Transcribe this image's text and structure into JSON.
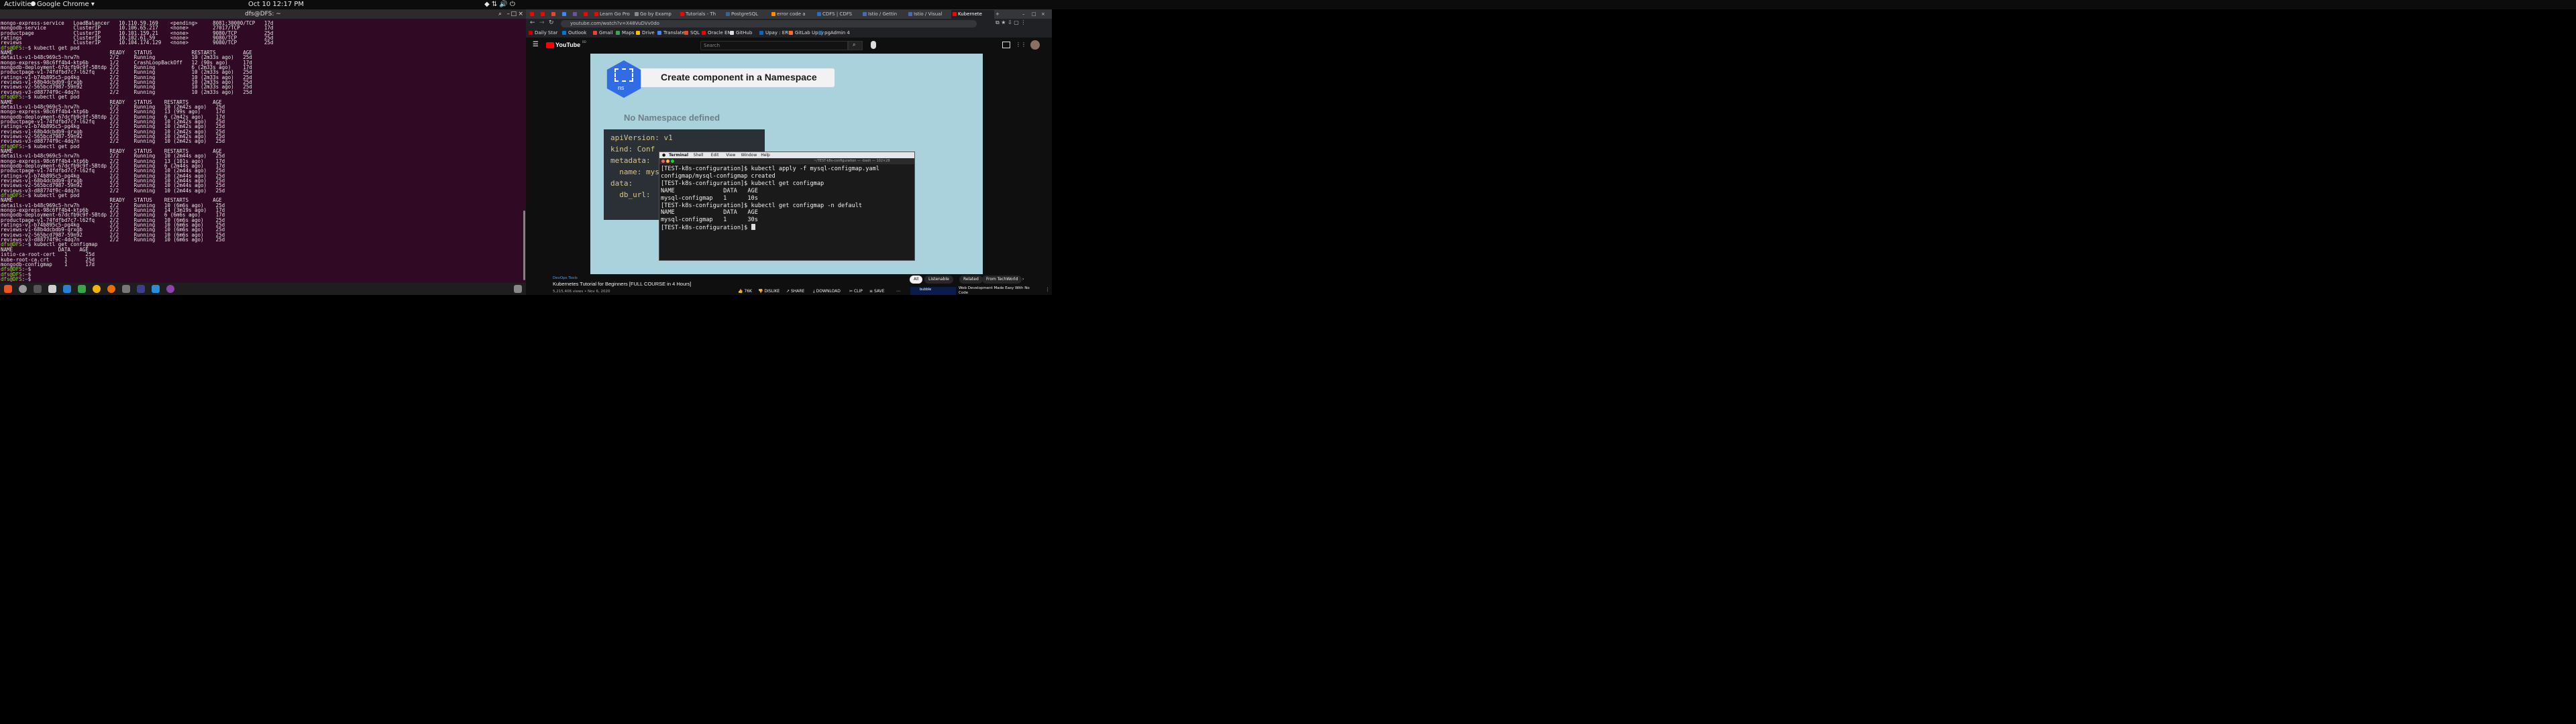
{
  "topbar": {
    "activities": "Activities",
    "app": "Google Chrome",
    "clock": "Oct 10  12:17 PM"
  },
  "terminal": {
    "title": "dfs@DFS: ~",
    "lines": [
      "mongo-express-service   LoadBalancer   10.110.59.169    <pending>     8081:30000/TCP   17d",
      "mongodb-service         ClusterIP      10.106.65.217    <none>        27017/TCP        17d",
      "productpage             ClusterIP      10.101.159.21    <none>        9080/TCP         25d",
      "ratings                 ClusterIP      10.102.61.59     <none>        9080/TCP         25d",
      "reviews                 ClusterIP      10.104.174.129   <none>        9080/TCP         25d",
      "$dfs@DFS:~$ kubectl get pod",
      "NAME                                READY   STATUS             RESTARTS         AGE",
      "details-v1-b48c969c5-hrw7h          2/2     Running            10 (2m33s ago)   25d",
      "mongo-express-98c6ff4b4-ktp6b       1/2     CrashLoopBackOff   12 (90s ago)     17d",
      "mongodb-deployment-67dcfb9c9f-5Btdp 2/2     Running            6 (2m33s ago)    17d",
      "productpage-v1-74fdfbd7c7-l62fq     2/2     Running            10 (2m33s ago)   25d",
      "ratings-v1-b74b895c5-pg4kg          2/2     Running            10 (2m33s ago)   25d",
      "reviews-v1-68b4dcbdb9-qrxgb         2/2     Running            10 (2m33s ago)   25d",
      "reviews-v2-565bcd7987-59n92         2/2     Running            10 (2m33s ago)   25d",
      "reviews-v3-d88774f9c-4dq7n          2/2     Running            10 (2m33s ago)   25d",
      "$dfs@DFS:~$ kubectl get pod",
      "NAME                                READY   STATUS    RESTARTS        AGE",
      "details-v1-b48c969c5-hrw7h          2/2     Running   10 (2m42s ago)   25d",
      "mongo-express-98c6ff4b4-ktp6b       2/2     Running   13 (99s ago)     17d",
      "mongodb-deployment-67dcfb9c9f-5Btdp 2/2     Running   6 (2m42s ago)    17d",
      "productpage-v1-74fdfbd7c7-l62fq     2/2     Running   10 (2m42s ago)   25d",
      "ratings-v1-b74b895c5-pg4kg          2/2     Running   10 (2m42s ago)   25d",
      "reviews-v1-68b4dcbdb9-qrxgb         2/2     Running   10 (2m42s ago)   25d",
      "reviews-v2-565bcd7987-59n92         2/2     Running   10 (2m42s ago)   25d",
      "reviews-v3-d88774f9c-4dq7n          2/2     Running   10 (2m42s ago)   25d",
      "$dfs@DFS:~$ kubectl get pod",
      "NAME                                READY   STATUS    RESTARTS        AGE",
      "details-v1-b48c969c5-hrw7h          2/2     Running   10 (2m44s ago)   25d",
      "mongo-express-98c6ff4b4-ktp6b       2/2     Running   13 (101s ago)    17d",
      "mongodb-deployment-67dcfb9c9f-5Btdp 2/2     Running   6 (2m44s ago)    17d",
      "productpage-v1-74fdfbd7c7-l62fq     2/2     Running   10 (2m44s ago)   25d",
      "ratings-v1-b74b895c5-pg4kg          2/2     Running   10 (2m44s ago)   25d",
      "reviews-v1-68b4dcbdb9-qrxgb         2/2     Running   10 (2m44s ago)   25d",
      "reviews-v2-565bcd7987-59n92         2/2     Running   10 (2m44s ago)   25d",
      "reviews-v3-d88774f9c-4dq7n          2/2     Running   10 (2m44s ago)   25d",
      "$dfs@DFS:~$ kubectl get pod",
      "NAME                                READY   STATUS    RESTARTS        AGE",
      "details-v1-b48c969c5-hrw7h          2/2     Running   10 (6m6s ago)    25d",
      "mongo-express-98c6ff4b4-ktp6b       2/2     Running   14 (3m19s ago)   17d",
      "mongodb-deployment-67dcfb9c9f-5Btdp 2/2     Running   6 (6m6s ago)     17d",
      "productpage-v1-74fdfbd7c7-l62fq     2/2     Running   10 (6m6s ago)    25d",
      "ratings-v1-b74b895c5-pg4kg          2/2     Running   10 (6m6s ago)    25d",
      "reviews-v1-68b4dcbdb9-qrxgb         2/2     Running   10 (6m6s ago)    25d",
      "reviews-v2-565bcd7987-59n92         2/2     Running   10 (6m6s ago)    25d",
      "reviews-v3-d88774f9c-4dq7n          2/2     Running   10 (6m6s ago)    25d",
      "$dfs@DFS:~$ kubectl get configmap",
      "NAME               DATA   AGE",
      "istio-ca-root-cert   1      25d",
      "kube-root-ca.crt     1      25d",
      "mongodb-configmap    1      17d",
      "$dfs@DFS:~$",
      "$dfs@DFS:~$",
      "$dfs@DFS:~$"
    ]
  },
  "chrome": {
    "tabs": [
      {
        "label": "",
        "color": "#ff0000"
      },
      {
        "label": "",
        "color": "#ff0000"
      },
      {
        "label": "",
        "color": "#ea4335"
      },
      {
        "label": "",
        "color": "#4285f4"
      },
      {
        "label": "",
        "color": "#6e5494"
      },
      {
        "label": "",
        "color": "#ff0000"
      },
      {
        "label": "Learn Go Pro",
        "color": "#ff0000"
      },
      {
        "label": "Go by Examp",
        "color": "#888888"
      },
      {
        "label": "Tutorials - Th",
        "color": "#ff0000"
      },
      {
        "label": "PostgreSQL",
        "color": "#336791"
      },
      {
        "label": "error code a",
        "color": "#ff8c00"
      },
      {
        "label": "CDFS | CDFS",
        "color": "#2a6ebb"
      },
      {
        "label": "Istio / Gettin",
        "color": "#466bb0"
      },
      {
        "label": "Istio / Visual",
        "color": "#466bb0"
      },
      {
        "label": "Kubernete",
        "color": "#ff0000"
      }
    ],
    "url": "youtube.com/watch?v=X48VuDVv0do",
    "bookmarks": [
      {
        "label": "Daily Star",
        "color": "#cc0000"
      },
      {
        "label": "Outlook",
        "color": "#0078d4"
      },
      {
        "label": "Gmail",
        "color": "#ea4335"
      },
      {
        "label": "Maps",
        "color": "#34a853"
      },
      {
        "label": "Drive",
        "color": "#fbbc04"
      },
      {
        "label": "Translate",
        "color": "#4285f4"
      },
      {
        "label": "SQL",
        "color": "#e44d26"
      },
      {
        "label": "Oracle EM",
        "color": "#f80000"
      },
      {
        "label": "GitHub",
        "color": "#dddddd"
      },
      {
        "label": "Upay : ERP",
        "color": "#0a66c2"
      },
      {
        "label": "GitLab Upay",
        "color": "#fc6d26"
      },
      {
        "label": "pgAdmin 4",
        "color": "#336791"
      }
    ]
  },
  "youtube": {
    "logo": "YouTube",
    "logo_region": "BD",
    "search_placeholder": "Search",
    "video": {
      "banner": "Create component in a Namespace",
      "hex_label": "ns",
      "subtitle": "No Namespace defined",
      "code": [
        "apiVersion: v1",
        "kind: Conf",
        "metadata:",
        "  name: mys",
        "data:",
        "  db_url: "
      ],
      "mac_menu": [
        "Terminal",
        "Shell",
        "Edit",
        "View",
        "Window",
        "Help"
      ],
      "mac_title": "~/TEST-k8s-configuration — -bash — 102×28",
      "mac_lines": [
        "[TEST-k8s-configuration]$ kubectl apply -f mysql-configmap.yaml",
        "configmap/mysql-configmap created",
        "[TEST-k8s-configuration]$ kubectl get configmap",
        "NAME              DATA   AGE",
        "mysql-configmap   1      10s",
        "[TEST-k8s-configuration]$ kubectl get configmap -n default",
        "NAME              DATA   AGE",
        "mysql-configmap   1      30s",
        "[TEST-k8s-configuration]$ "
      ]
    },
    "channel": "DevOps Tools",
    "title": "Kubernetes Tutorial for Beginners [FULL COURSE in 4 Hours]",
    "meta": "5,215,406 views • Nov 6, 2020",
    "likes": "76K",
    "dislike": "DISLIKE",
    "share": "SHARE",
    "download": "DOWNLOAD",
    "clip": "CLIP",
    "save": "SAVE",
    "chips": [
      "All",
      "Listenable",
      "Related",
      "From TechWorld"
    ],
    "rec_title": "Web Development Made Easy With No Code",
    "rec_brand": "bubble"
  }
}
